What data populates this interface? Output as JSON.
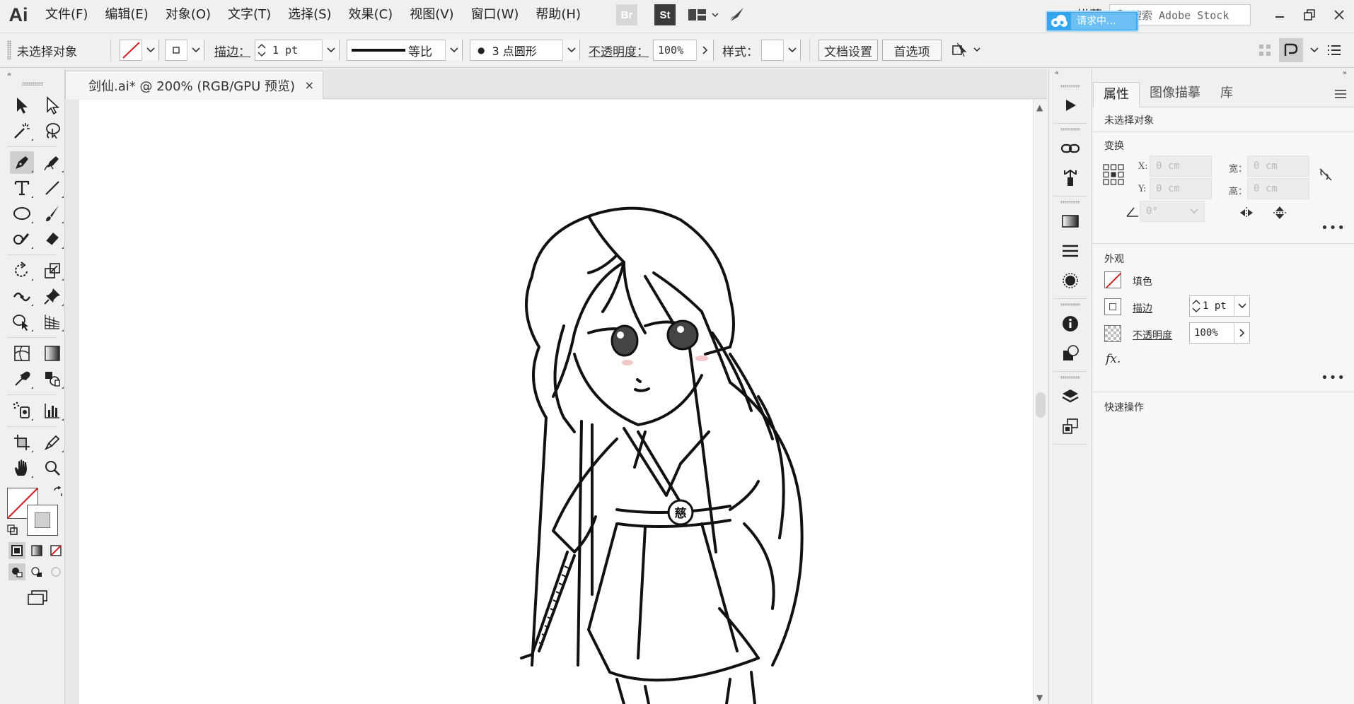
{
  "app": {
    "logo": "Ai",
    "menus": [
      "文件(F)",
      "编辑(E)",
      "对象(O)",
      "文字(T)",
      "选择(S)",
      "效果(C)",
      "视图(V)",
      "窗口(W)",
      "帮助(H)"
    ],
    "bridge_label": "Br",
    "stock_label": "St",
    "trace_label": "描摹",
    "search_placeholder": "搜索 Adobe Stock",
    "cloud_badge": "请求中..."
  },
  "control": {
    "selection_status": "未选择对象",
    "stroke_label": "描边：",
    "stroke_weight": "1 pt",
    "profile_label": "等比",
    "brush_label": "3 点圆形",
    "opacity_label": "不透明度：",
    "opacity_value": "100%",
    "style_label": "样式：",
    "doc_setup_button": "文档设置",
    "prefs_button": "首选项"
  },
  "document": {
    "tab_title": "剑仙.ai* @ 200% (RGB/GPU 预览)",
    "close_glyph": "×",
    "belt_emblem": "慈"
  },
  "panel": {
    "tabs": [
      "属性",
      "图像描摹",
      "库"
    ],
    "selection_status": "未选择对象",
    "transform_title": "变换",
    "x_label": "X:",
    "y_label": "Y:",
    "w_label": "宽：",
    "h_label": "高：",
    "x_value": "0 cm",
    "y_value": "0 cm",
    "w_value": "0 cm",
    "h_value": "0 cm",
    "angle_value": "0°",
    "appearance_title": "外观",
    "fill_label": "填色",
    "stroke_label": "描边",
    "stroke_value": "1 pt",
    "opacity_label": "不透明度",
    "opacity_value": "100%",
    "fx_label": "fx.",
    "quick_actions_title": "快速操作",
    "more_glyph": "•••"
  },
  "colors": {
    "accent_blue": "#34a6f0",
    "no_fill_red": "#d42020",
    "ui_gray": "#f0f0f0"
  }
}
